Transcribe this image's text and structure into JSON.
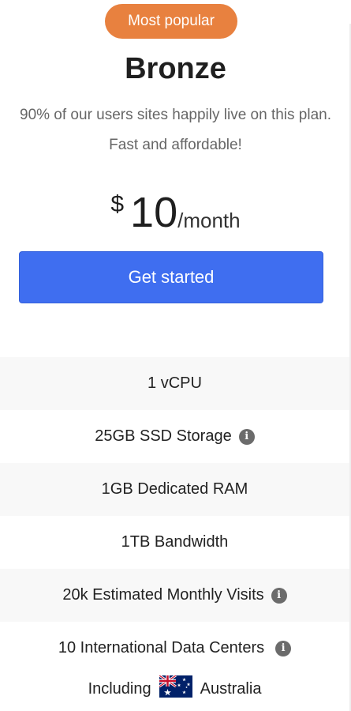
{
  "plan": {
    "badge": "Most popular",
    "name": "Bronze",
    "description": "90% of our users sites happily live on this plan. Fast and affordable!",
    "price": {
      "currency": "$",
      "amount": "10",
      "period": "/month"
    },
    "cta_label": "Get started"
  },
  "features": [
    {
      "label": "1 vCPU",
      "info": false
    },
    {
      "label": "25GB SSD Storage",
      "info": true
    },
    {
      "label": "1GB Dedicated RAM",
      "info": false
    },
    {
      "label": "1TB Bandwidth",
      "info": false
    },
    {
      "label": "20k Estimated Monthly Visits",
      "info": true
    },
    {
      "label": "10 International Data Centers",
      "info": true
    }
  ],
  "location": {
    "prefix": "Including",
    "country": "Australia",
    "flag_icon": "australia-flag-icon"
  },
  "colors": {
    "badge": "#e8813f",
    "cta": "#3f6ef0",
    "info_icon": "#6b6b6b"
  }
}
